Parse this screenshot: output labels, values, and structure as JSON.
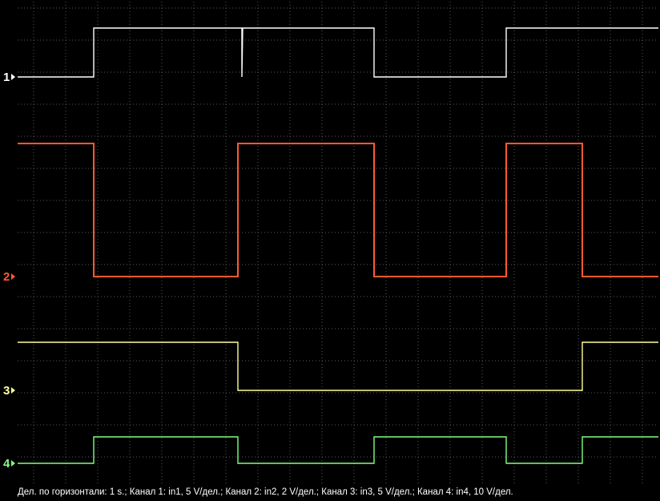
{
  "chart_data": {
    "type": "line",
    "title": "",
    "xlabel": "",
    "ylabel": "",
    "x_unit": "s",
    "x_range": [
      0,
      8
    ],
    "grid": true,
    "series": [
      {
        "name": "1",
        "label": "1",
        "color": "#ffffff",
        "points": [
          [
            0,
            0
          ],
          [
            0.95,
            0
          ],
          [
            0.95,
            1
          ],
          [
            2.8,
            1
          ],
          [
            2.8,
            0
          ],
          [
            2.81,
            1
          ],
          [
            4.45,
            1
          ],
          [
            4.45,
            0
          ],
          [
            6.1,
            0
          ],
          [
            6.1,
            1
          ],
          [
            8,
            1
          ]
        ]
      },
      {
        "name": "2",
        "label": "2",
        "color": "#ff5a30",
        "points": [
          [
            0,
            1
          ],
          [
            0.95,
            1
          ],
          [
            0.95,
            0
          ],
          [
            2.75,
            0
          ],
          [
            2.75,
            1
          ],
          [
            4.45,
            1
          ],
          [
            4.45,
            0
          ],
          [
            6.1,
            0
          ],
          [
            6.1,
            1
          ],
          [
            7.05,
            1
          ],
          [
            7.05,
            0
          ],
          [
            8,
            0
          ]
        ]
      },
      {
        "name": "3",
        "label": "3",
        "color": "#ffff99",
        "points": [
          [
            0,
            1
          ],
          [
            2.75,
            1
          ],
          [
            2.75,
            0
          ],
          [
            7.05,
            0
          ],
          [
            7.05,
            1
          ],
          [
            8,
            1
          ]
        ]
      },
      {
        "name": "4",
        "label": "4",
        "color": "#7fff7f",
        "points": [
          [
            0,
            0
          ],
          [
            0.95,
            0
          ],
          [
            0.95,
            1
          ],
          [
            2.75,
            1
          ],
          [
            2.75,
            0
          ],
          [
            4.45,
            0
          ],
          [
            4.45,
            1
          ],
          [
            6.1,
            1
          ],
          [
            6.1,
            0
          ],
          [
            7.05,
            0
          ],
          [
            7.05,
            1
          ],
          [
            8,
            1
          ]
        ]
      }
    ]
  },
  "footer": "Дел. по горизонтали: 1 s.; Канал 1: in1, 5 V/дел.; Канал 2: in2, 2 V/дел.; Канал 3: in3, 5 V/дел.; Канал 4: in4, 10 V/дел."
}
